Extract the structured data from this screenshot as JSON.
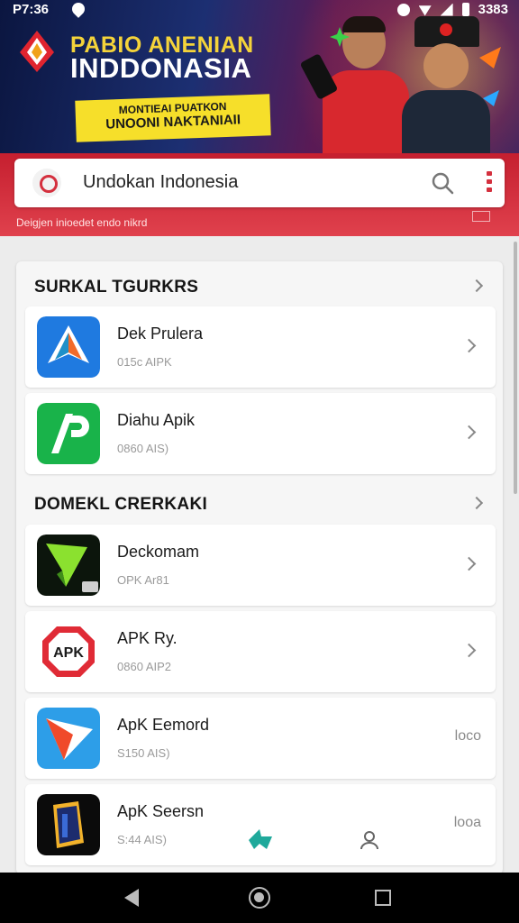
{
  "status_bar": {
    "time": "P7:36",
    "battery_text": "3383"
  },
  "banner": {
    "title_line1": "PABIO ANENIAN",
    "title_line2": "INDDONASIA",
    "promo_line1": "ΜΟΝΤΙΕΑΙ ΡUΑΤΚΟΝ",
    "promo_line2": "UNOONI NAKTANIAII"
  },
  "search": {
    "query": "Undokan Indonesia",
    "hint": "Deigjen inioedet endo nikrd"
  },
  "sections": [
    {
      "title": "SURKAL TGURKRS",
      "items": [
        {
          "name": "Dek Prulera",
          "meta": "015c AIPK",
          "icon": "compass-app-icon",
          "trailing": "chevron"
        },
        {
          "name": "Diahu Apik",
          "meta": "0860 AIS)",
          "icon": "ap-app-icon",
          "trailing": "chevron"
        }
      ]
    },
    {
      "title": "DOMEKL CRERKAKI",
      "items": [
        {
          "name": "Deckomam",
          "meta": "OPK Ar81",
          "icon": "green-arrow-app-icon",
          "trailing": "chevron"
        },
        {
          "name": "APK Ry.",
          "meta": "0860 AIP2",
          "icon": "apk-badge-app-icon",
          "trailing": "chevron"
        },
        {
          "name": "ApK Eemord",
          "meta": "S150 AIS)",
          "icon": "paper-plane-app-icon",
          "trailing": "text",
          "extra": "loco"
        },
        {
          "name": "ApK Seersn",
          "meta": "S:44 AIS)",
          "icon": "shield-app-icon",
          "trailing": "text",
          "extra": "looa"
        }
      ]
    }
  ],
  "colors": {
    "brand_red": "#d62b39",
    "banner_yellow": "#f4d33a"
  }
}
